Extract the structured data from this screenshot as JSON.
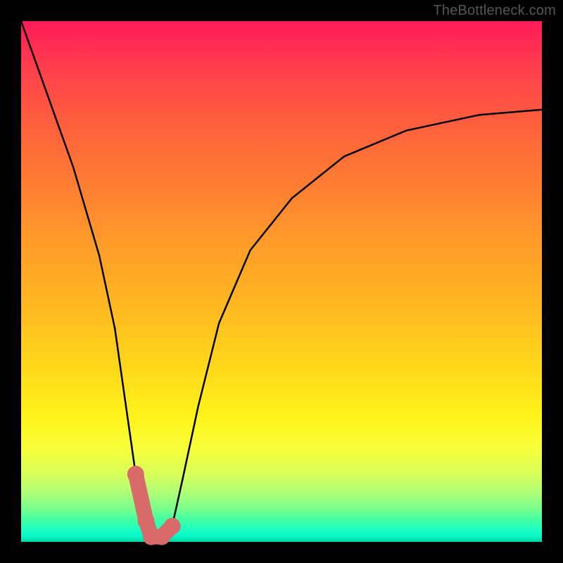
{
  "watermark": "TheBottleneck.com",
  "colors": {
    "background": "#000000",
    "gradient_top": "#ff1a5a",
    "gradient_bottom": "#02d6a0",
    "curve": "#000000",
    "valley_band": "#d86a6a"
  },
  "chart_data": {
    "type": "line",
    "title": "",
    "xlabel": "",
    "ylabel": "",
    "xlim": [
      0,
      100
    ],
    "ylim": [
      0,
      100
    ],
    "grid": false,
    "series": [
      {
        "name": "bottleneck-curve",
        "x": [
          0,
          5,
          10,
          15,
          18,
          20,
          22,
          24,
          25,
          27,
          29,
          31,
          34,
          38,
          44,
          52,
          62,
          74,
          88,
          100
        ],
        "y": [
          100,
          86,
          72,
          55,
          41,
          27,
          13,
          4,
          1,
          1,
          3,
          12,
          26,
          42,
          56,
          66,
          74,
          79,
          82,
          83
        ]
      }
    ],
    "annotations": [
      {
        "name": "optimal-band",
        "x": [
          22,
          24,
          25,
          27,
          29
        ],
        "y": [
          13,
          4,
          1,
          1,
          3
        ]
      }
    ]
  }
}
